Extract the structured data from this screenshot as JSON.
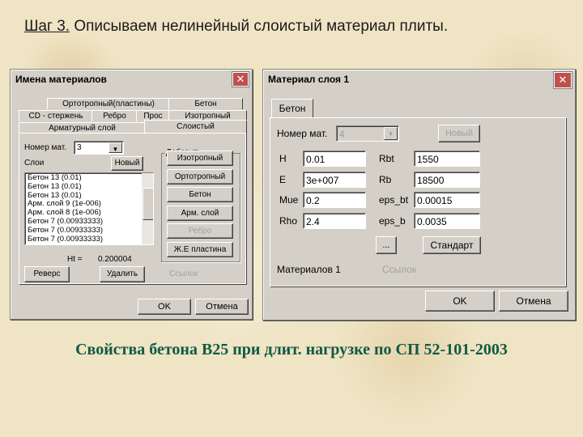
{
  "slide": {
    "title_step": "Шаг 3.",
    "title_text": " Описываем нелинейный слоистый материал плиты.",
    "caption": "Свойства бетона В25 при длит. нагрузке по СП 52-101-2003"
  },
  "names_dialog": {
    "title": "Имена материалов",
    "tabs_row1": [
      "Ортотропный(пластины)",
      "Бетон"
    ],
    "tabs_row2": [
      "CD - стержень",
      "Ребро",
      "Прос",
      "Изотропный"
    ],
    "tabs_row3": [
      "Арматурный слой",
      "Слоистый"
    ],
    "material_number_label": "Номер мат.",
    "material_number_value": "3",
    "layers_label": "Слои",
    "new_button": "Новый",
    "layers": [
      "Бетон 13 (0.01)",
      "Бетон 13 (0.01)",
      "Бетон 13 (0.01)",
      "Арм. слой 9 (1е-006)",
      "Арм. слой 8 (1е-006)",
      "Бетон 7 (0.00933333)",
      "Бетон 7 (0.00933333)",
      "Бетон 7 (0.00933333)"
    ],
    "add_group_label": "Добавить",
    "add_buttons": [
      "Изотропный",
      "Ортотропный",
      "Бетон",
      "Арм. слой",
      "Ребро",
      "Ж.Е пластина"
    ],
    "add_buttons_disabled": [
      false,
      false,
      false,
      false,
      true,
      false
    ],
    "ht_label": "Ht =",
    "ht_value": "0.200004",
    "reverse_button": "Реверс",
    "delete_button": "Удалить",
    "link_label": "Ссылок",
    "ok_button": "OK",
    "cancel_button": "Отмена"
  },
  "layer_dialog": {
    "title": "Материал слоя 1",
    "tab": "Бетон",
    "material_number_label": "Номер мат.",
    "material_number_value": "4",
    "new_button": "Новый",
    "fields_left": [
      {
        "label": "H",
        "value": "0.01"
      },
      {
        "label": "E",
        "value": "3е+007"
      },
      {
        "label": "Mue",
        "value": "0.2"
      },
      {
        "label": "Rho",
        "value": "2.4"
      }
    ],
    "fields_right": [
      {
        "label": "Rbt",
        "value": "1550"
      },
      {
        "label": "Rb",
        "value": "18500"
      },
      {
        "label": "eps_bt",
        "value": "0.00015"
      },
      {
        "label": "eps_b",
        "value": "0.0035"
      }
    ],
    "dots_button": "...",
    "standard_button": "Стандарт",
    "materials_label": "Материалов 1",
    "links_label": "Ссылок",
    "ok_button": "OK",
    "cancel_button": "Отмена"
  },
  "colors": {
    "background": "#efe4c4",
    "caption": "#0f5a44",
    "dialog": "#d4d0c8",
    "close": "#c0504d"
  }
}
